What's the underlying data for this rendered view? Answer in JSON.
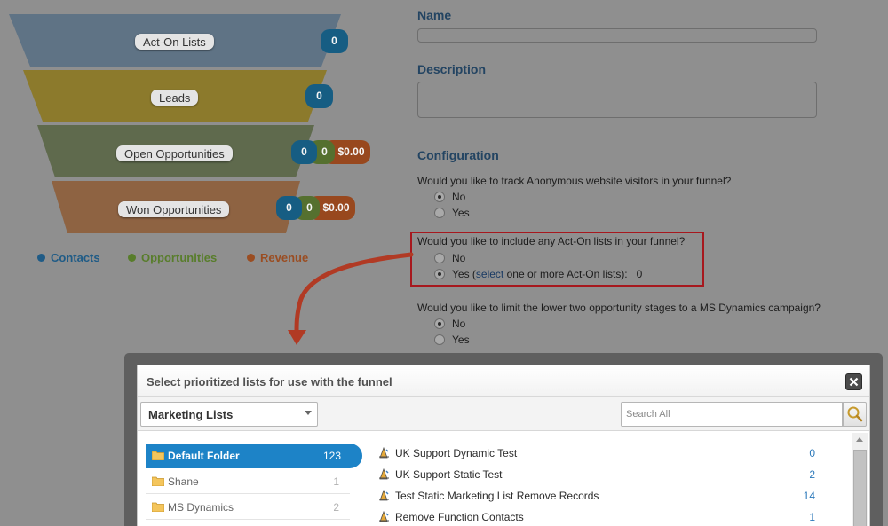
{
  "funnel": {
    "stages": [
      {
        "label": "Act-On Lists",
        "contacts": "0"
      },
      {
        "label": "Leads",
        "contacts": "0"
      },
      {
        "label": "Open Opportunities",
        "contacts": "0",
        "opportunities": "0",
        "revenue": "$0.00"
      },
      {
        "label": "Won Opportunities",
        "contacts": "0",
        "opportunities": "0",
        "revenue": "$0.00"
      }
    ],
    "colors": {
      "stage1": "#5f7385",
      "stage2": "#8c7a2c",
      "stage3": "#5f6a4d",
      "stage4": "#8e6342"
    },
    "legend": [
      {
        "label": "Contacts",
        "color": "#1f5b86"
      },
      {
        "label": "Opportunities",
        "color": "#587d2b"
      },
      {
        "label": "Revenue",
        "color": "#9a4d22"
      }
    ]
  },
  "form": {
    "name_label": "Name",
    "name_value": "",
    "description_label": "Description",
    "description_value": "",
    "configuration_label": "Configuration",
    "q1": {
      "text": "Would you like to track Anonymous website visitors in your funnel?",
      "no": "No",
      "yes": "Yes",
      "selected": "No"
    },
    "q2": {
      "text": "Would you like to include any Act-On lists in your funnel?",
      "no": "No",
      "yes_prefix": "Yes (",
      "yes_link": "select",
      "yes_suffix": " one or more Act-On lists):",
      "yes_count": "0",
      "selected": "Yes"
    },
    "q3": {
      "text": "Would you like to limit the lower two opportunity stages to a MS Dynamics campaign?",
      "no": "No",
      "yes": "Yes",
      "selected": "No"
    }
  },
  "dialog": {
    "title": "Select prioritized lists for use with the funnel",
    "list_type": "Marketing Lists",
    "search_placeholder": "Search All",
    "folders": [
      {
        "name": "Default Folder",
        "count": "123",
        "active": true
      },
      {
        "name": "Shane",
        "count": "1",
        "active": false
      },
      {
        "name": "MS Dynamics",
        "count": "2",
        "active": false
      }
    ],
    "lists": [
      {
        "name": "UK Support Dynamic Test",
        "count": "0"
      },
      {
        "name": "UK Support Static Test",
        "count": "2"
      },
      {
        "name": "Test Static Marketing List Remove Records",
        "count": "14"
      },
      {
        "name": "Remove Function Contacts",
        "count": "1"
      }
    ]
  }
}
